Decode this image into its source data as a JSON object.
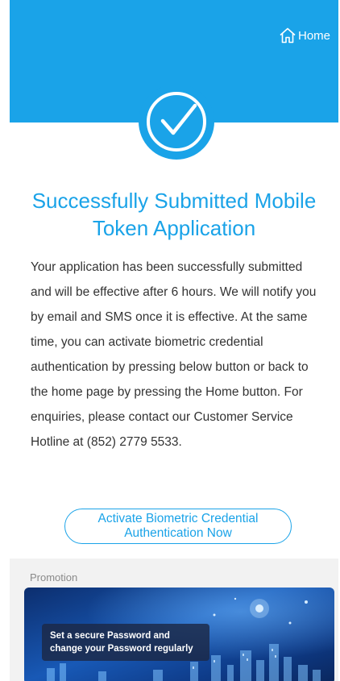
{
  "header": {
    "home_label": "Home",
    "background_color": "#1aa3e8"
  },
  "status": {
    "icon": "check-circle-icon",
    "title": "Successfully Submitted Mobile Token Application",
    "message": "Your application has been successfully submitted and will be effective after 6 hours. We will notify you by email and SMS once it is effective. At the same time, you can activate biometric credential authentication by pressing below button or back to the home page by pressing the Home button. For enquiries, please contact our Customer Service Hotline at (852) 2779 5533."
  },
  "actions": {
    "activate_label": "Activate Biometric Credential Authentication Now"
  },
  "promotion": {
    "section_label": "Promotion",
    "banner_caption": "Set a secure Password and change your Password regularly"
  },
  "colors": {
    "accent": "#1aa3e8",
    "text": "#333333",
    "muted": "#8a8a8a"
  }
}
